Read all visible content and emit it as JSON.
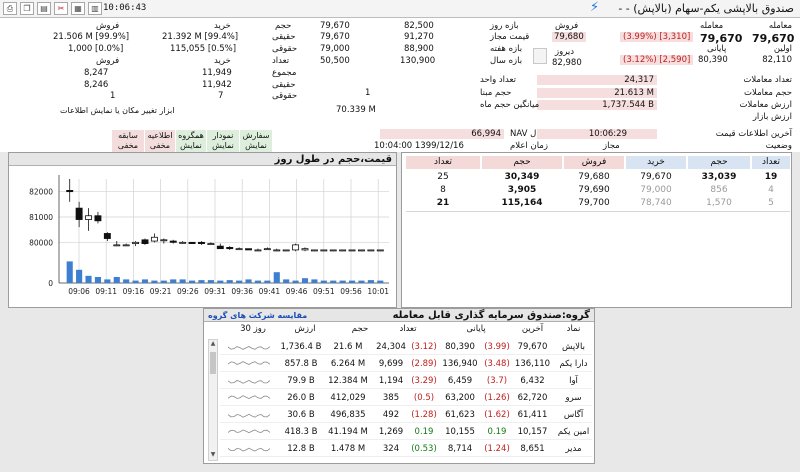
{
  "toolbar": {
    "time": "10:06:43",
    "title": "صندوق بالاپشی یکم-سهام (بالاپش) - -",
    "icons": [
      "print-icon",
      "copy-icon",
      "doc-icon",
      "tools-icon",
      "grid-icon",
      "chart-icon"
    ]
  },
  "price_box": {
    "trans_label": "معامله",
    "trans_value": "79,670",
    "trans_change": "(3.99%) [3,310]",
    "final_label": "پایانی",
    "final_value": "80,390",
    "final_change": "(3.12%) [2,590]",
    "open_label": "اولین",
    "open_value": "82,110",
    "sell_label": "فروش",
    "sell_value": "79,680",
    "yesterday_label": "دیروز",
    "yesterday_value": "82,980"
  },
  "ranges": {
    "day_label": "بازه روز",
    "day_low": "79,670",
    "day_high": "82,500",
    "allowed_label": "قیمت مجاز",
    "allowed_low": "79,670",
    "allowed_high": "91,270",
    "week_label": "بازه هفته",
    "week_low": "79,000",
    "week_high": "88,900",
    "year_label": "بازه سال",
    "year_low": "50,500",
    "year_high": "130,900"
  },
  "stats": {
    "count_label": "تعداد معاملات",
    "count_value": "24,317",
    "volume_label": "حجم معاملات",
    "volume_value": "21.613 M",
    "value_label": "ارزش معاملات",
    "value_value": "1,737.544 B",
    "market_label": "ارزش بازار",
    "base_label": "حجم مبنا",
    "base_value": "1",
    "unit_label": "تعداد واحد",
    "avg_label": "میانگین حجم ماه",
    "avg_value": "70.339 M"
  },
  "client": {
    "buy_label": "خرید",
    "sell_label": "فروش",
    "volume_label": "حجم",
    "real_label": "حقیقی",
    "legal_label": "حقوقی",
    "count_label": "تعداد",
    "real_buy": "21.392 M [99.4%]",
    "legal_buy": "115,055 [0.5%]",
    "real_sell": "21.506 M [99.9%]",
    "legal_sell": "1,000 [0.0%]",
    "sum_label": "مجموع",
    "real_count_label": "حقیقی",
    "legal_count_label": "حقوقی",
    "buy_sum": "11,949",
    "buy_real": "11,942",
    "buy_legal": "7",
    "sell_sum": "8,247",
    "sell_real": "8,246",
    "sell_legal": "1",
    "sell_head": "فروش",
    "buy_head": "خرید"
  },
  "nav": {
    "nav_label": "NAV ابطال",
    "nav_value": "66,994",
    "nav_time_label": "زمان اعلام",
    "nav_time_value": "10:04:00 1399/12/16",
    "price_info_label": "آخرین اطلاعات قیمت",
    "price_info_value": "10:06:29",
    "status_label": "وضعیت",
    "status_value": "مجاز"
  },
  "tools": {
    "hint": "ابزار تغییر مکان یا نمایش اطلاعات",
    "buttons": [
      {
        "line1": "سفارش",
        "line2": "نمایش",
        "style": "green"
      },
      {
        "line1": "نمودار",
        "line2": "نمایش",
        "style": "green"
      },
      {
        "line1": "همگروه",
        "line2": "نمایش",
        "style": "green"
      },
      {
        "line1": "اطلاعیه",
        "line2": "مخفی",
        "style": "pink"
      },
      {
        "line1": "سابقه",
        "line2": "مخفی",
        "style": "pink"
      }
    ]
  },
  "chart_panel": {
    "title": "قیمت،حجم در طول روز"
  },
  "chart_data": {
    "type": "candlestick",
    "title": "قیمت،حجم در طول روز",
    "y_ticks": [
      0,
      80000,
      81000,
      82000
    ],
    "x_ticks": [
      "09:06",
      "09:11",
      "09:16",
      "09:21",
      "09:26",
      "09:31",
      "09:36",
      "09:41",
      "09:46",
      "09:51",
      "09:56",
      "10:01"
    ],
    "ylim_price": [
      79500,
      82500
    ],
    "grid": true,
    "candles": [
      {
        "o": 82050,
        "h": 82500,
        "l": 81600,
        "c": 82000
      },
      {
        "o": 81350,
        "h": 81600,
        "l": 80600,
        "c": 80900
      },
      {
        "o": 80900,
        "h": 81350,
        "l": 80450,
        "c": 81050
      },
      {
        "o": 81050,
        "h": 81200,
        "l": 80750,
        "c": 80850
      },
      {
        "o": 80350,
        "h": 80400,
        "l": 80050,
        "c": 80150
      },
      {
        "o": 79900,
        "h": 80050,
        "l": 79850,
        "c": 79900
      },
      {
        "o": 79900,
        "h": 79950,
        "l": 79850,
        "c": 79900
      },
      {
        "o": 79950,
        "h": 80050,
        "l": 79850,
        "c": 80000
      },
      {
        "o": 80100,
        "h": 80150,
        "l": 79900,
        "c": 79950
      },
      {
        "o": 80050,
        "h": 80350,
        "l": 80000,
        "c": 80200
      },
      {
        "o": 80100,
        "h": 80150,
        "l": 79950,
        "c": 80100
      },
      {
        "o": 80050,
        "h": 80100,
        "l": 79950,
        "c": 80000
      },
      {
        "o": 80000,
        "h": 80050,
        "l": 79950,
        "c": 80000
      },
      {
        "o": 80000,
        "h": 80000,
        "l": 79950,
        "c": 79950
      },
      {
        "o": 80000,
        "h": 80050,
        "l": 79900,
        "c": 79950
      },
      {
        "o": 79950,
        "h": 80000,
        "l": 79900,
        "c": 79950
      },
      {
        "o": 79850,
        "h": 79950,
        "l": 79750,
        "c": 79750
      },
      {
        "o": 79800,
        "h": 79850,
        "l": 79700,
        "c": 79750
      },
      {
        "o": 79750,
        "h": 79800,
        "l": 79700,
        "c": 79750
      },
      {
        "o": 79750,
        "h": 79750,
        "l": 79700,
        "c": 79700
      },
      {
        "o": 79700,
        "h": 79750,
        "l": 79700,
        "c": 79700
      },
      {
        "o": 79750,
        "h": 79800,
        "l": 79700,
        "c": 79750
      },
      {
        "o": 79700,
        "h": 79750,
        "l": 79650,
        "c": 79700
      },
      {
        "o": 79700,
        "h": 79700,
        "l": 79650,
        "c": 79700
      },
      {
        "o": 79700,
        "h": 79950,
        "l": 79650,
        "c": 79900
      },
      {
        "o": 79700,
        "h": 79800,
        "l": 79650,
        "c": 79750
      },
      {
        "o": 79700,
        "h": 79700,
        "l": 79650,
        "c": 79700
      },
      {
        "o": 79700,
        "h": 79700,
        "l": 79650,
        "c": 79700
      },
      {
        "o": 79700,
        "h": 79700,
        "l": 79650,
        "c": 79700
      },
      {
        "o": 79700,
        "h": 79700,
        "l": 79650,
        "c": 79700
      },
      {
        "o": 79700,
        "h": 79700,
        "l": 79650,
        "c": 79700
      },
      {
        "o": 79700,
        "h": 79700,
        "l": 79650,
        "c": 79700
      },
      {
        "o": 79700,
        "h": 79700,
        "l": 79650,
        "c": 79700
      },
      {
        "o": 79700,
        "h": 79700,
        "l": 79650,
        "c": 79700
      }
    ],
    "volumes": [
      0.9,
      0.55,
      0.3,
      0.25,
      0.15,
      0.25,
      0.15,
      0.1,
      0.15,
      0.1,
      0.1,
      0.15,
      0.15,
      0.1,
      0.12,
      0.12,
      0.1,
      0.12,
      0.1,
      0.15,
      0.1,
      0.1,
      0.45,
      0.15,
      0.1,
      0.2,
      0.15,
      0.1,
      0.1,
      0.1,
      0.1,
      0.1,
      0.12,
      0.1
    ]
  },
  "orders": {
    "headers": [
      "تعداد",
      "حجم",
      "خرید",
      "فروش",
      "حجم",
      "تعداد"
    ],
    "rows": [
      {
        "buy_count": "19",
        "buy_volume": "33,039",
        "buy_price": "79,670",
        "sell_price": "79,680",
        "sell_volume": "30,349",
        "sell_count": "25",
        "style": "bold"
      },
      {
        "buy_count": "4",
        "buy_volume": "856",
        "buy_price": "79,000",
        "sell_price": "79,690",
        "sell_volume": "3,905",
        "sell_count": "8",
        "style": "gray"
      },
      {
        "buy_count": "5",
        "buy_volume": "1,570",
        "buy_price": "78,740",
        "sell_price": "79,700",
        "sell_volume": "115,164",
        "sell_count": "21",
        "style": "gray"
      }
    ]
  },
  "group": {
    "title": "گروه:صندوق سرمایه گذاری قابل معامله",
    "compare_link": "مقایسه شرکت های گروه",
    "headers": [
      "نماد",
      "آخرین",
      "پایانی",
      "تعداد",
      "حجم",
      "ارزش",
      "30 روز"
    ],
    "rows": [
      {
        "symbol": "بالاپش",
        "last": "79,670",
        "last_chg": "(3.99)",
        "final": "80,390",
        "final_chg": "(3.12)",
        "count": "24,304",
        "volume": "21.6 M",
        "value": "1,736.4 B",
        "last_dir": "red",
        "final_dir": "red"
      },
      {
        "symbol": "دارا یکم",
        "last": "136,110",
        "last_chg": "(3.48)",
        "final": "136,940",
        "final_chg": "(2.89)",
        "count": "9,699",
        "volume": "6.264 M",
        "value": "857.8 B",
        "last_dir": "red",
        "final_dir": "red"
      },
      {
        "symbol": "آوا",
        "last": "6,432",
        "last_chg": "(3.7)",
        "final": "6,459",
        "final_chg": "(3.29)",
        "count": "1,194",
        "volume": "12.384 M",
        "value": "79.9 B",
        "last_dir": "red",
        "final_dir": "red"
      },
      {
        "symbol": "سرو",
        "last": "62,720",
        "last_chg": "(1.26)",
        "final": "63,200",
        "final_chg": "(0.5)",
        "count": "385",
        "volume": "412,029",
        "value": "26.0 B",
        "last_dir": "red",
        "final_dir": "red"
      },
      {
        "symbol": "آگاس",
        "last": "61,411",
        "last_chg": "(1.62)",
        "final": "61,623",
        "final_chg": "(1.28)",
        "count": "492",
        "volume": "496,835",
        "value": "30.6 B",
        "last_dir": "red",
        "final_dir": "red"
      },
      {
        "symbol": "امین یکم",
        "last": "10,157",
        "last_chg": "0.19",
        "final": "10,155",
        "final_chg": "0.19",
        "count": "1,269",
        "volume": "41.194 M",
        "value": "418.3 B",
        "last_dir": "green",
        "final_dir": "green"
      },
      {
        "symbol": "مدیر",
        "last": "8,651",
        "last_chg": "(1.24)",
        "final": "8,714",
        "final_chg": "(0.53)",
        "count": "324",
        "volume": "1.478 M",
        "value": "12.8 B",
        "last_dir": "red",
        "final_dir": "green"
      }
    ]
  }
}
